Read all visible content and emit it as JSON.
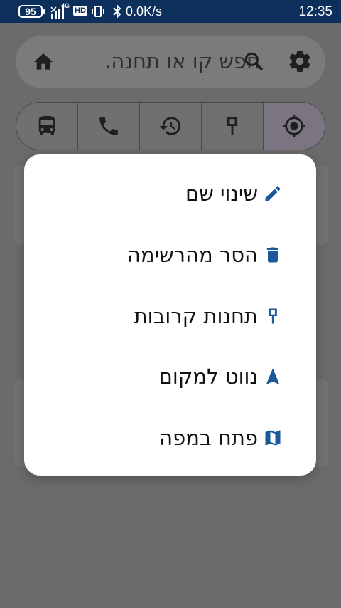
{
  "status_bar": {
    "battery": "95",
    "network": "4G",
    "hd": "HD",
    "speed": "0.0K/s",
    "time": "12:35"
  },
  "search": {
    "placeholder": "חפש קו או תחנה."
  },
  "tabs": [
    {
      "icon": "bus-icon"
    },
    {
      "icon": "phone-icon"
    },
    {
      "icon": "history-icon"
    },
    {
      "icon": "bus-stop-icon"
    },
    {
      "icon": "my-location-icon",
      "active": true
    }
  ],
  "menu": {
    "items": [
      {
        "label": "שינוי שם",
        "icon": "pencil-icon"
      },
      {
        "label": "הסר מהרשימה",
        "icon": "trash-icon"
      },
      {
        "label": "תחנות קרובות",
        "icon": "bus-stop-icon"
      },
      {
        "label": "נווט למקום",
        "icon": "navigation-arrow-icon"
      },
      {
        "label": "פתח במפה",
        "icon": "map-icon"
      }
    ]
  },
  "colors": {
    "status_bar": "#0c2f5c",
    "icon_accent": "#1a5a9a",
    "scrim": "#6b6b6b"
  }
}
